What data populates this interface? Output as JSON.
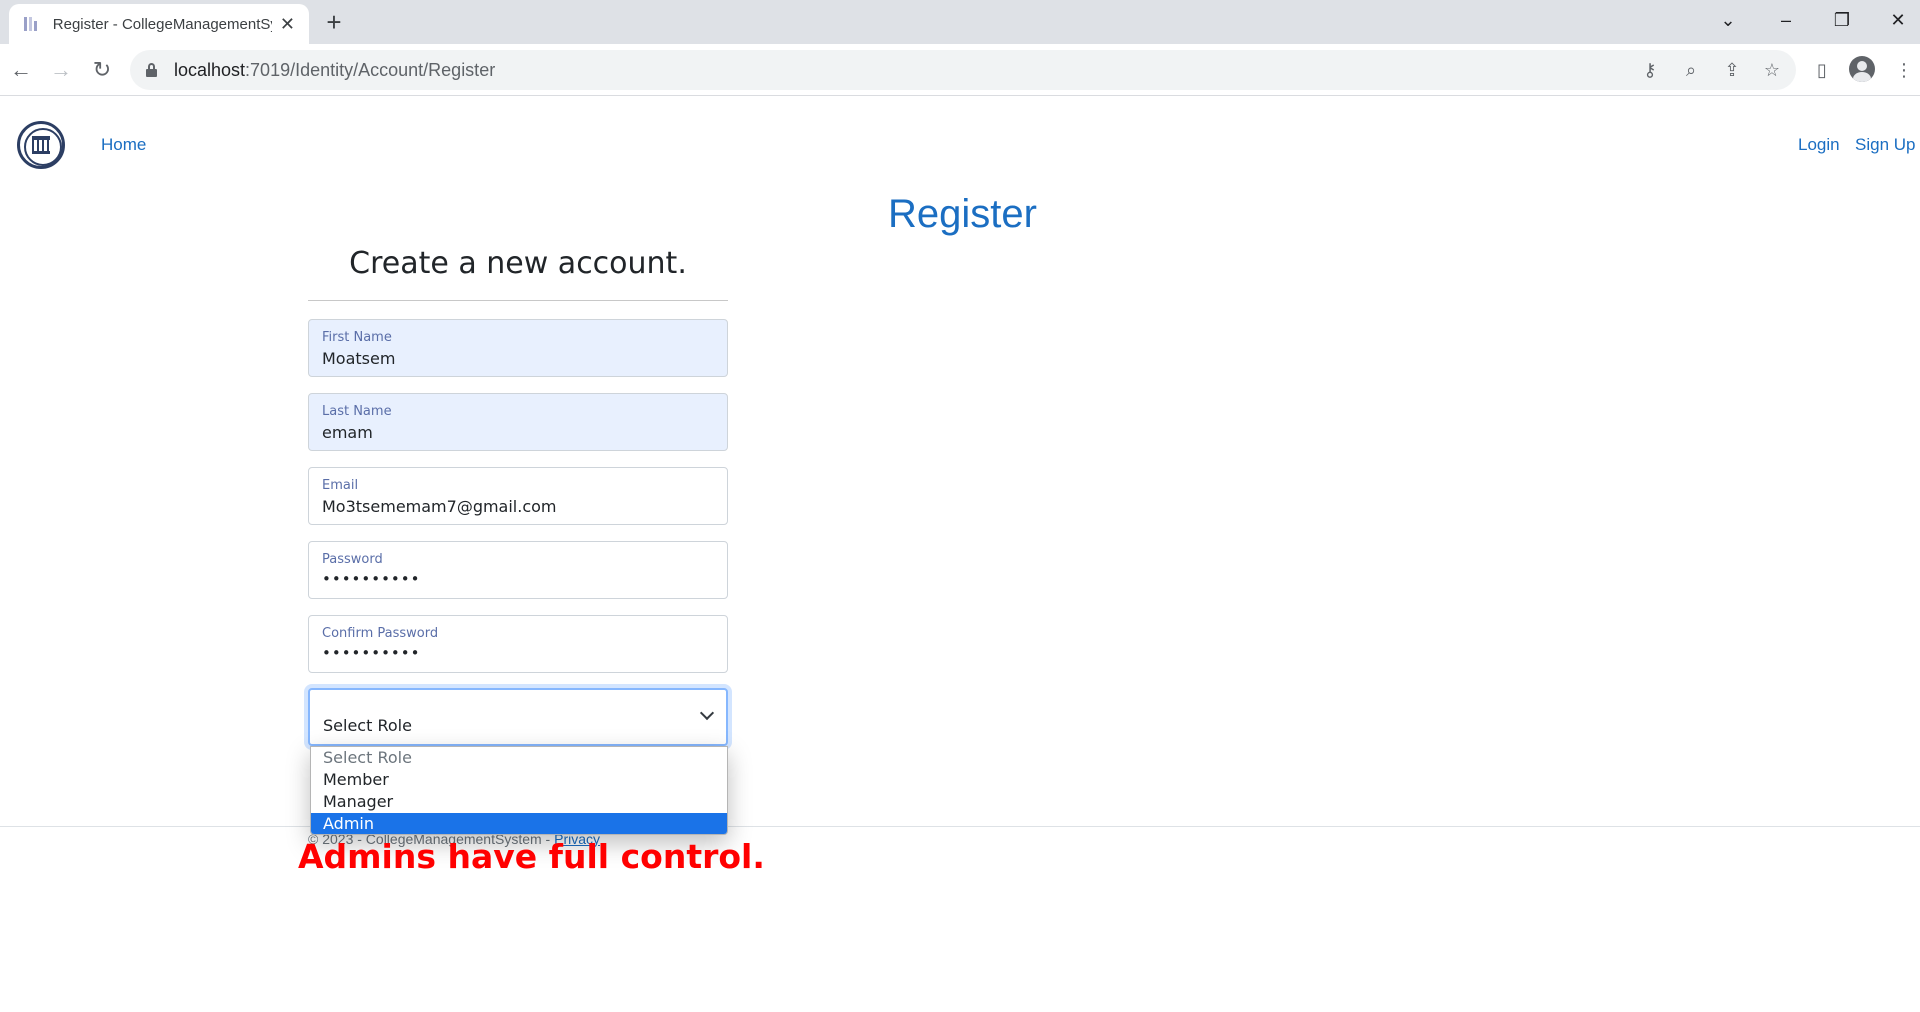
{
  "browser": {
    "tab_title": "Register - CollegeManagementSy",
    "close_glyph": "✕",
    "newtab_glyph": "+",
    "url_host": "localhost",
    "url_rest": ":7019/Identity/Account/Register"
  },
  "navbar": {
    "home": "Home",
    "login": "Login",
    "signup": "Sign Up"
  },
  "page": {
    "title": "Register",
    "subtitle": "Create a new account."
  },
  "form": {
    "first_name": {
      "label": "First Name",
      "value": "Moatsem"
    },
    "last_name": {
      "label": "Last Name",
      "value": "emam"
    },
    "email": {
      "label": "Email",
      "value": "Mo3tsememam7@gmail.com"
    },
    "password": {
      "label": "Password",
      "value": "••••••••••"
    },
    "confirm_password": {
      "label": "Confirm Password",
      "value": "••••••••••"
    },
    "role": {
      "selected": "Select Role",
      "options": [
        "Select Role",
        "Member",
        "Manager",
        "Admin"
      ],
      "highlighted": "Admin"
    }
  },
  "footer": {
    "text": "© 2023 - CollegeManagementSystem - ",
    "privacy": "Privacy"
  },
  "annotation": "Admins have full control.",
  "colors": {
    "link": "#1b6ec2",
    "autofill_bg": "#e8f0fe",
    "highlight": "#1a73e8",
    "annotation": "#ff0000"
  }
}
